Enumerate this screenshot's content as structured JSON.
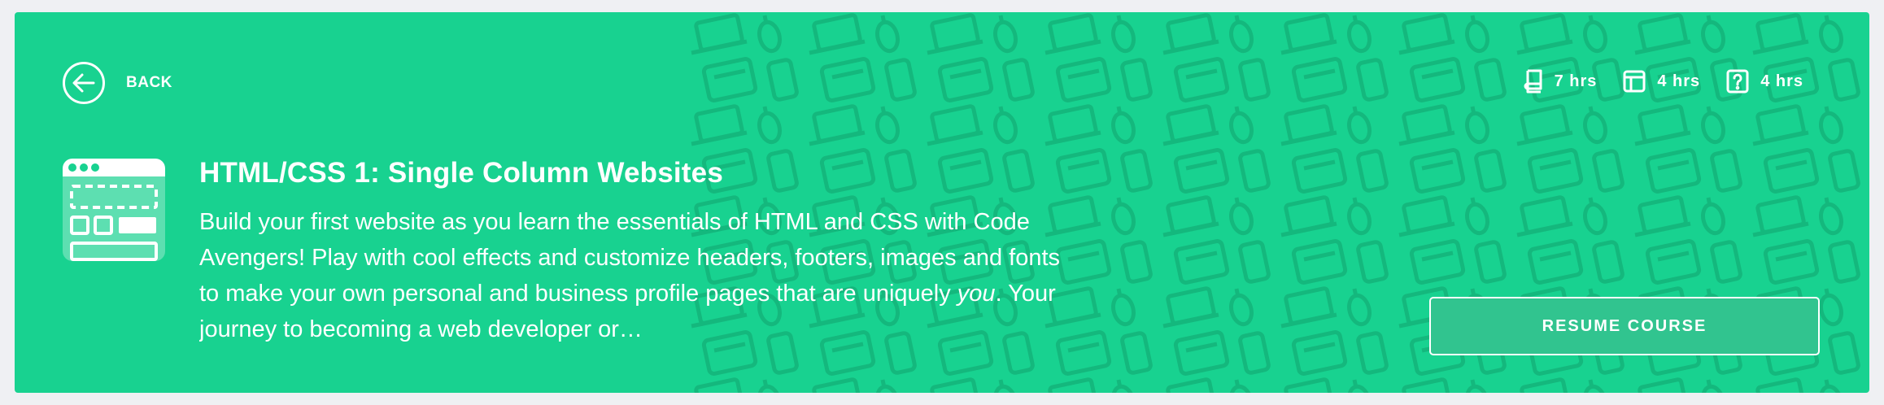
{
  "colors": {
    "banner_bg": "#18d290",
    "page_bg": "#eff0f3",
    "text": "#ffffff",
    "pattern": "#14b87d"
  },
  "header": {
    "back_label": "BACK",
    "stats": [
      {
        "icon": "book-icon",
        "value": "7 hrs"
      },
      {
        "icon": "layout-icon",
        "value": "4 hrs"
      },
      {
        "icon": "question-icon",
        "value": "4 hrs"
      }
    ]
  },
  "course": {
    "icon": "website-layout-icon",
    "title": "HTML/CSS 1: Single Column Websites",
    "description_before": "Build your first website as you learn the essentials of HTML and CSS with Code Avengers! Play with cool effects and customize headers, footers, images and fonts to make your own personal and business profile pages that are uniquely ",
    "description_emphasis": "you",
    "description_after": ". Your journey to becoming a web developer or…"
  },
  "actions": {
    "resume_label": "RESUME COURSE"
  }
}
